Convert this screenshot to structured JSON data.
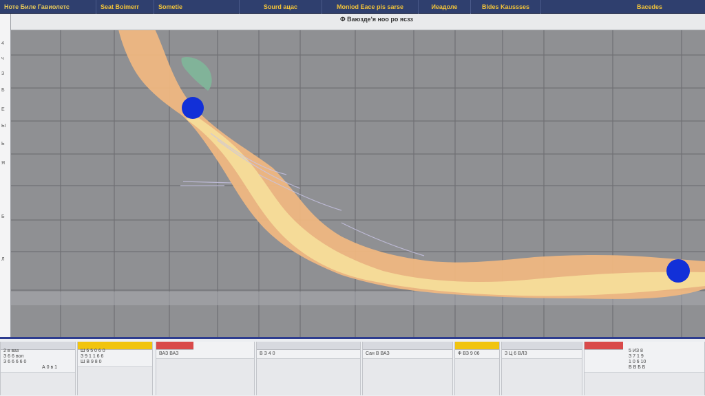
{
  "header": {
    "items": [
      "Ноте Биле Гавиолетс",
      "Seat Boimerr",
      "Sometie",
      "Sourd ацас",
      "Moniod Eace pis sarse",
      "Иеадоле",
      "Bldes Kaussses",
      "Bacedes"
    ]
  },
  "subheader": {
    "text": "Ф Ваюзде'я ноо ро ясзз"
  },
  "ruler": {
    "ticks": [
      "4",
      "ч",
      "З",
      "Б",
      "Е",
      "Ы",
      "Ь",
      "Я",
      "Б",
      "Л"
    ]
  },
  "bottom": {
    "panels": [
      {
        "lines": [
          "2 в ваз",
          "З 6 6 вол",
          "З 6 6 6 6 0",
          "А 0 в 1"
        ]
      },
      {
        "lines": [
          "Ш 6 5 0 6 0",
          "З 9 1 1 6 6",
          "Ш В 9 8 0"
        ]
      },
      {
        "lines": [
          "ВАЗ ВАЗ"
        ]
      },
      {
        "lines": [
          "В З 4 0"
        ]
      },
      {
        "lines": [
          "Сан В ВАЗ"
        ]
      },
      {
        "lines": [
          "Ф ВЗ 9 06"
        ]
      },
      {
        "lines": [
          "З Ц 6 ВЛЗ"
        ]
      },
      {
        "lines": [
          "5 ИЗ 8",
          "З 7 1 9",
          "1 0 6 10",
          "В В Б Б"
        ]
      }
    ]
  },
  "colors": {
    "plot_bg": "#8f9093",
    "grid": "#6f7074",
    "band_orange": "#f2b880",
    "band_yellow": "#f6df9a",
    "marker_blue": "#1230d8",
    "header_bg": "#2f3f6e",
    "header_text": "#f0c23a"
  },
  "markers": [
    "blue-marker-start",
    "blue-marker-end"
  ]
}
